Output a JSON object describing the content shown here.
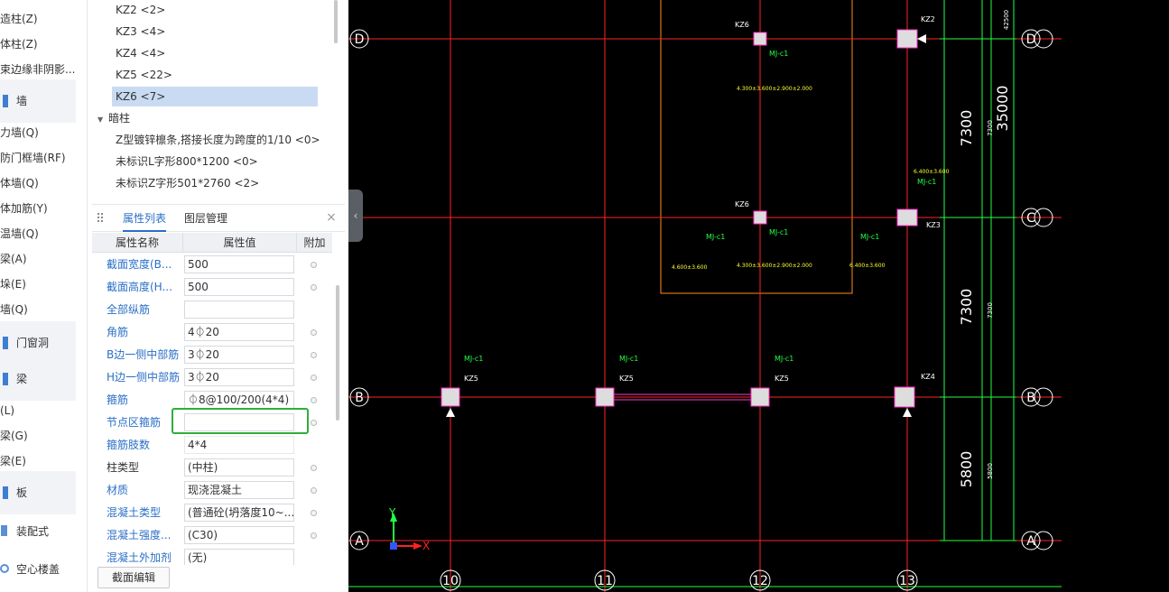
{
  "left_nav": {
    "items": [
      {
        "label": "造柱(Z)"
      },
      {
        "label": "体柱(Z)"
      },
      {
        "label": "束边缘非阴影..."
      },
      {
        "label": "力墙(Q)"
      },
      {
        "label": "防门框墙(RF)"
      },
      {
        "label": "体墙(Q)"
      },
      {
        "label": "体加筋(Y)"
      },
      {
        "label": "温墙(Q)"
      },
      {
        "label": "梁(A)"
      },
      {
        "label": "垛(E)"
      },
      {
        "label": "墙(Q)"
      },
      {
        "label": "(L)"
      },
      {
        "label": "梁(G)"
      },
      {
        "label": "梁(E)"
      },
      {
        "label": "装配式"
      },
      {
        "label": "空心楼盖"
      }
    ],
    "groups": [
      {
        "label": "墙"
      },
      {
        "label": "门窗洞"
      },
      {
        "label": "梁"
      },
      {
        "label": "板"
      }
    ]
  },
  "tree": {
    "items": [
      {
        "label": "KZ2 <2>"
      },
      {
        "label": "KZ3 <4>"
      },
      {
        "label": "KZ4 <4>"
      },
      {
        "label": "KZ5 <22>"
      },
      {
        "label": "KZ6 <7>"
      }
    ],
    "group_label": "暗柱",
    "group_items": [
      {
        "label": "Z型镀锌檩条,搭接长度为跨度的1/10 <0>"
      },
      {
        "label": "未标识L字形800*1200 <0>"
      },
      {
        "label": "未标识Z字形501*2760 <2>"
      }
    ]
  },
  "props": {
    "tab_attr": "属性列表",
    "tab_layer": "图层管理",
    "close": "×",
    "col_name": "属性名称",
    "col_value": "属性值",
    "col_extra": "附加",
    "rows": [
      {
        "name": "截面宽度(B...",
        "value": "500"
      },
      {
        "name": "截面高度(H...",
        "value": "500"
      },
      {
        "name": "全部纵筋",
        "value": ""
      },
      {
        "name": "角筋",
        "value": "4⏀20"
      },
      {
        "name": "B边一侧中部筋",
        "value": "3⏀20"
      },
      {
        "name": "H边一侧中部筋",
        "value": "3⏀20"
      },
      {
        "name": "箍筋",
        "value": "⏀8@100/200(4*4)"
      },
      {
        "name": "节点区箍筋",
        "value": ""
      },
      {
        "name": "箍筋肢数",
        "value": "4*4"
      },
      {
        "name": "柱类型",
        "value": "(中柱)"
      },
      {
        "name": "材质",
        "value": "现浇混凝土"
      },
      {
        "name": "混凝土类型",
        "value": "(普通砼(坍落度10~..."
      },
      {
        "name": "混凝土强度...",
        "value": "(C30)"
      },
      {
        "name": "混凝土外加剂",
        "value": "(无)"
      }
    ],
    "section_edit_label": "截面编辑"
  },
  "cad": {
    "axis_rows": [
      "D",
      "C",
      "B",
      "A"
    ],
    "axis_cols": [
      "10",
      "11",
      "12",
      "13"
    ],
    "dims_vertical": [
      "7300",
      "7300",
      "5800",
      "35000"
    ],
    "dims_small": [
      "7300",
      "7300",
      "5800",
      "42500"
    ],
    "column_tags": [
      "KZ6",
      "KZ6",
      "KZ2",
      "KZ3",
      "KZ5",
      "KZ5",
      "KZ5",
      "KZ4"
    ],
    "mj_label": "MJ-c1",
    "level_label_1": "4.300±3.600±2.900±2.000",
    "level_label_2": "4.600±3.600",
    "level_label_3": "6.400±3.600",
    "ucs_x": "X",
    "ucs_y": "Y",
    "colors": {
      "grid_red": "#ff2222",
      "dim_green": "#22ff44",
      "text_yellow": "#ffff33",
      "text_white": "#ffffff",
      "orange": "#ff8c1a",
      "magenta": "#ff33cc"
    }
  }
}
